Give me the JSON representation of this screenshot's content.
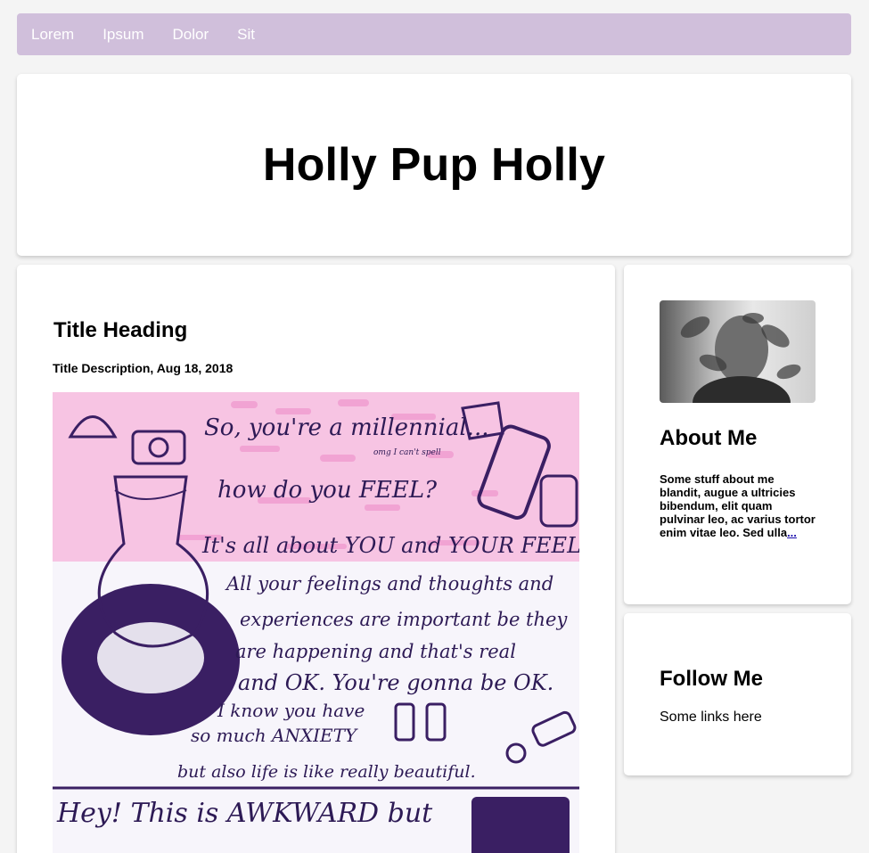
{
  "nav": {
    "items": [
      {
        "label": "Lorem"
      },
      {
        "label": "Ipsum"
      },
      {
        "label": "Dolor"
      },
      {
        "label": "Sit"
      }
    ]
  },
  "header": {
    "title": "Holly Pup Holly"
  },
  "post": {
    "title": "Title Heading",
    "description": "Title Description, Aug 18, 2018",
    "image_text": [
      "So, you're a millennial...",
      "omg I can't spell",
      "how do you FEEL?",
      "It's all about YOU and YOUR FEELINGS",
      "All your feelings and thoughts and",
      "experiences are important be they",
      "are happening and that's real",
      "and OK. You're gonna be OK.",
      "I know you have",
      "so much ANXIETY",
      "but also life is like really beautiful.",
      "Hey! This is AWKWARD but"
    ]
  },
  "about": {
    "heading": "About Me",
    "text": "Some stuff about me blandit, augue a ultricies bibendum, elit quam pulvinar leo, ac varius tortor enim vitae leo. Sed ulla",
    "more_link": "..."
  },
  "follow": {
    "heading": "Follow Me",
    "text": "Some links here"
  },
  "colors": {
    "nav_bg": "#d0bfdb",
    "page_bg": "#f4f4f4",
    "ink": "#3b2460",
    "pink": "#f2a8d6"
  }
}
